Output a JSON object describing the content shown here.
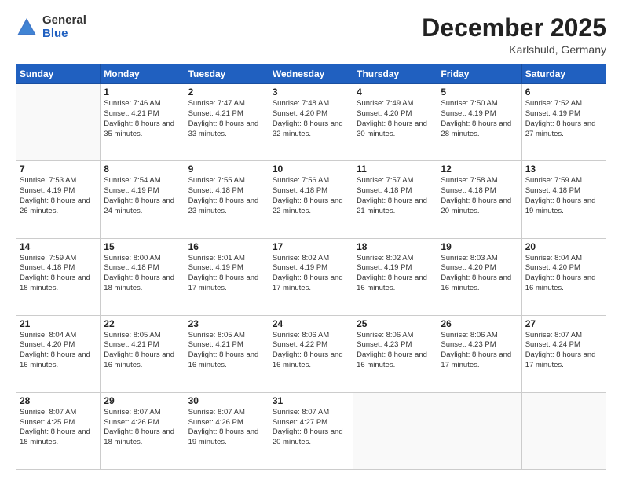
{
  "logo": {
    "general": "General",
    "blue": "Blue"
  },
  "header": {
    "month": "December 2025",
    "location": "Karlshuld, Germany"
  },
  "weekdays": [
    "Sunday",
    "Monday",
    "Tuesday",
    "Wednesday",
    "Thursday",
    "Friday",
    "Saturday"
  ],
  "weeks": [
    [
      {
        "day": "",
        "info": ""
      },
      {
        "day": "1",
        "info": "Sunrise: 7:46 AM\nSunset: 4:21 PM\nDaylight: 8 hours\nand 35 minutes."
      },
      {
        "day": "2",
        "info": "Sunrise: 7:47 AM\nSunset: 4:21 PM\nDaylight: 8 hours\nand 33 minutes."
      },
      {
        "day": "3",
        "info": "Sunrise: 7:48 AM\nSunset: 4:20 PM\nDaylight: 8 hours\nand 32 minutes."
      },
      {
        "day": "4",
        "info": "Sunrise: 7:49 AM\nSunset: 4:20 PM\nDaylight: 8 hours\nand 30 minutes."
      },
      {
        "day": "5",
        "info": "Sunrise: 7:50 AM\nSunset: 4:19 PM\nDaylight: 8 hours\nand 28 minutes."
      },
      {
        "day": "6",
        "info": "Sunrise: 7:52 AM\nSunset: 4:19 PM\nDaylight: 8 hours\nand 27 minutes."
      }
    ],
    [
      {
        "day": "7",
        "info": "Sunrise: 7:53 AM\nSunset: 4:19 PM\nDaylight: 8 hours\nand 26 minutes."
      },
      {
        "day": "8",
        "info": "Sunrise: 7:54 AM\nSunset: 4:19 PM\nDaylight: 8 hours\nand 24 minutes."
      },
      {
        "day": "9",
        "info": "Sunrise: 7:55 AM\nSunset: 4:18 PM\nDaylight: 8 hours\nand 23 minutes."
      },
      {
        "day": "10",
        "info": "Sunrise: 7:56 AM\nSunset: 4:18 PM\nDaylight: 8 hours\nand 22 minutes."
      },
      {
        "day": "11",
        "info": "Sunrise: 7:57 AM\nSunset: 4:18 PM\nDaylight: 8 hours\nand 21 minutes."
      },
      {
        "day": "12",
        "info": "Sunrise: 7:58 AM\nSunset: 4:18 PM\nDaylight: 8 hours\nand 20 minutes."
      },
      {
        "day": "13",
        "info": "Sunrise: 7:59 AM\nSunset: 4:18 PM\nDaylight: 8 hours\nand 19 minutes."
      }
    ],
    [
      {
        "day": "14",
        "info": "Sunrise: 7:59 AM\nSunset: 4:18 PM\nDaylight: 8 hours\nand 18 minutes."
      },
      {
        "day": "15",
        "info": "Sunrise: 8:00 AM\nSunset: 4:18 PM\nDaylight: 8 hours\nand 18 minutes."
      },
      {
        "day": "16",
        "info": "Sunrise: 8:01 AM\nSunset: 4:19 PM\nDaylight: 8 hours\nand 17 minutes."
      },
      {
        "day": "17",
        "info": "Sunrise: 8:02 AM\nSunset: 4:19 PM\nDaylight: 8 hours\nand 17 minutes."
      },
      {
        "day": "18",
        "info": "Sunrise: 8:02 AM\nSunset: 4:19 PM\nDaylight: 8 hours\nand 16 minutes."
      },
      {
        "day": "19",
        "info": "Sunrise: 8:03 AM\nSunset: 4:20 PM\nDaylight: 8 hours\nand 16 minutes."
      },
      {
        "day": "20",
        "info": "Sunrise: 8:04 AM\nSunset: 4:20 PM\nDaylight: 8 hours\nand 16 minutes."
      }
    ],
    [
      {
        "day": "21",
        "info": "Sunrise: 8:04 AM\nSunset: 4:20 PM\nDaylight: 8 hours\nand 16 minutes."
      },
      {
        "day": "22",
        "info": "Sunrise: 8:05 AM\nSunset: 4:21 PM\nDaylight: 8 hours\nand 16 minutes."
      },
      {
        "day": "23",
        "info": "Sunrise: 8:05 AM\nSunset: 4:21 PM\nDaylight: 8 hours\nand 16 minutes."
      },
      {
        "day": "24",
        "info": "Sunrise: 8:06 AM\nSunset: 4:22 PM\nDaylight: 8 hours\nand 16 minutes."
      },
      {
        "day": "25",
        "info": "Sunrise: 8:06 AM\nSunset: 4:23 PM\nDaylight: 8 hours\nand 16 minutes."
      },
      {
        "day": "26",
        "info": "Sunrise: 8:06 AM\nSunset: 4:23 PM\nDaylight: 8 hours\nand 17 minutes."
      },
      {
        "day": "27",
        "info": "Sunrise: 8:07 AM\nSunset: 4:24 PM\nDaylight: 8 hours\nand 17 minutes."
      }
    ],
    [
      {
        "day": "28",
        "info": "Sunrise: 8:07 AM\nSunset: 4:25 PM\nDaylight: 8 hours\nand 18 minutes."
      },
      {
        "day": "29",
        "info": "Sunrise: 8:07 AM\nSunset: 4:26 PM\nDaylight: 8 hours\nand 18 minutes."
      },
      {
        "day": "30",
        "info": "Sunrise: 8:07 AM\nSunset: 4:26 PM\nDaylight: 8 hours\nand 19 minutes."
      },
      {
        "day": "31",
        "info": "Sunrise: 8:07 AM\nSunset: 4:27 PM\nDaylight: 8 hours\nand 20 minutes."
      },
      {
        "day": "",
        "info": ""
      },
      {
        "day": "",
        "info": ""
      },
      {
        "day": "",
        "info": ""
      }
    ]
  ]
}
